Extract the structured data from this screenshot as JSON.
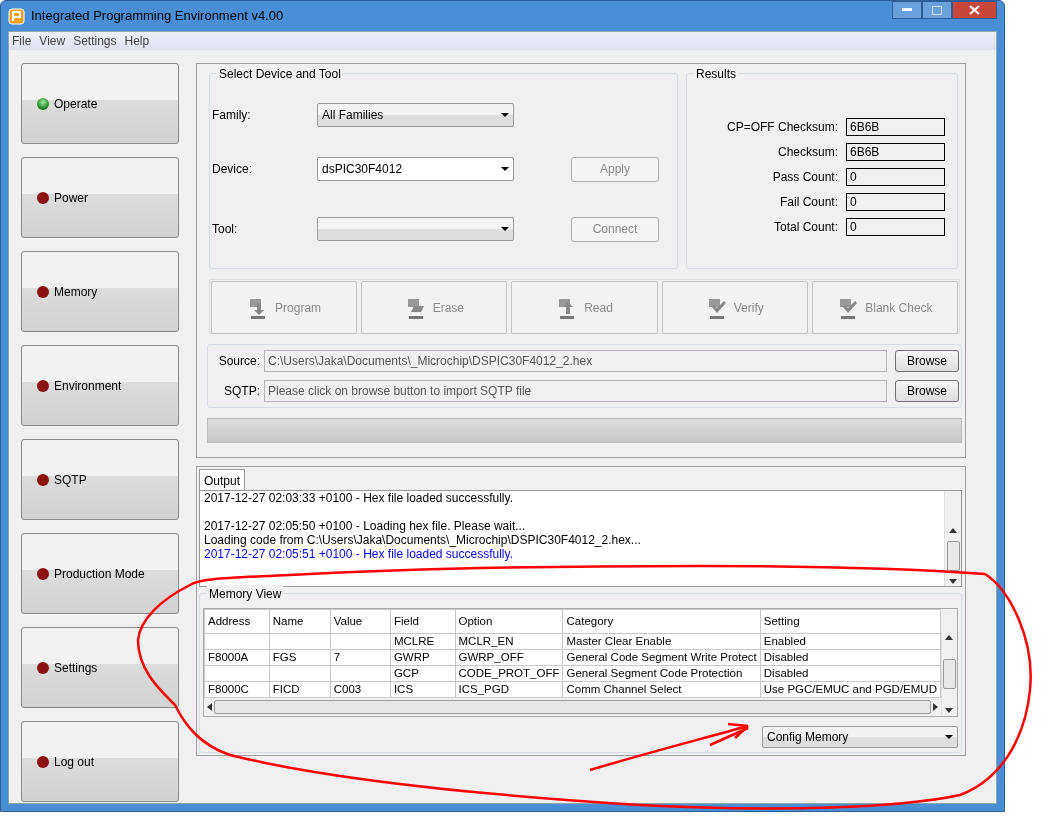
{
  "window": {
    "title": "Integrated Programming Environment v4.00"
  },
  "menu": [
    "File",
    "View",
    "Settings",
    "Help"
  ],
  "sidebar": [
    {
      "label": "Operate",
      "on": true
    },
    {
      "label": "Power",
      "on": false
    },
    {
      "label": "Memory",
      "on": false
    },
    {
      "label": "Environment",
      "on": false
    },
    {
      "label": "SQTP",
      "on": false
    },
    {
      "label": "Production Mode",
      "on": false
    },
    {
      "label": "Settings",
      "on": false
    },
    {
      "label": "Log out",
      "on": false
    }
  ],
  "device_group": {
    "title": "Select Device and Tool",
    "rows": [
      {
        "label": "Family:",
        "value": "All Families",
        "editable": false
      },
      {
        "label": "Device:",
        "value": "dsPIC30F4012",
        "editable": true,
        "button": {
          "label": "Apply",
          "disabled": true
        }
      },
      {
        "label": "Tool:",
        "editable": false,
        "button": {
          "label": "Connect",
          "disabled": true
        }
      }
    ]
  },
  "results": {
    "title": "Results",
    "rows": [
      {
        "label": "CP=OFF Checksum:",
        "value": "6B6B"
      },
      {
        "label": "Checksum:",
        "value": "6B6B"
      },
      {
        "label": "Pass Count:",
        "value": "0"
      },
      {
        "label": "Fail Count:",
        "value": "0"
      },
      {
        "label": "Total Count:",
        "value": "0"
      }
    ]
  },
  "actions": [
    {
      "kind": "program",
      "label": "Program",
      "disabled": true
    },
    {
      "kind": "erase",
      "label": "Erase",
      "disabled": true
    },
    {
      "kind": "read",
      "label": "Read",
      "disabled": true
    },
    {
      "kind": "verify",
      "label": "Verify",
      "disabled": true
    },
    {
      "kind": "blank",
      "label": "Blank Check",
      "disabled": true
    }
  ],
  "files": [
    {
      "label": "Source:",
      "value": "C:\\Users\\Jaka\\Documents\\_Microchip\\DSPIC30F4012_2.hex",
      "button": "Browse"
    },
    {
      "label": "SQTP:",
      "value": "Please click on browse button to import SQTP file",
      "button": "Browse"
    }
  ],
  "progress": {
    "level": 0
  },
  "output": {
    "tabs": [
      {
        "label": "Output",
        "selected": true
      }
    ],
    "lines": [
      {
        "text": "2017-12-27 02:03:33 +0100 - Hex file loaded successfully.",
        "color": "#000000",
        "blank_before": false
      },
      {
        "text": "2017-12-27 02:05:50 +0100 - Loading hex file. Please wait...",
        "color": "#000000",
        "blank_before": true
      },
      {
        "text": "Loading code from C:\\Users\\Jaka\\Documents\\_Microchip\\DSPIC30F4012_2.hex...",
        "color": "#000000",
        "blank_before": false
      },
      {
        "text": "2017-12-27 02:05:51 +0100 - Hex file loaded successfully.",
        "color": "#0000ff",
        "blank_before": false
      }
    ]
  },
  "memory_view": {
    "title": "Memory View",
    "table": {
      "columns": [
        "Address",
        "Name",
        "Value",
        "Field",
        "Option",
        "Category",
        "Setting"
      ],
      "rows": [
        [
          "",
          "",
          "",
          "MCLRE",
          "MCLR_EN",
          "Master Clear Enable",
          "Enabled"
        ],
        [
          "F8000A",
          "FGS",
          "7",
          "GWRP",
          "GWRP_OFF",
          "General Code Segment Write Protect",
          "Disabled"
        ],
        [
          "",
          "",
          "",
          "GCP",
          "CODE_PROT_OFF",
          "General Segment Code Protection",
          "Disabled"
        ],
        [
          "F8000C",
          "FICD",
          "C003",
          "ICS",
          "ICS_PGD",
          "Comm Channel Select",
          "Use PGC/EMUC and PGD/EMUD"
        ]
      ]
    },
    "memory_select": {
      "value": "Config Memory"
    }
  }
}
